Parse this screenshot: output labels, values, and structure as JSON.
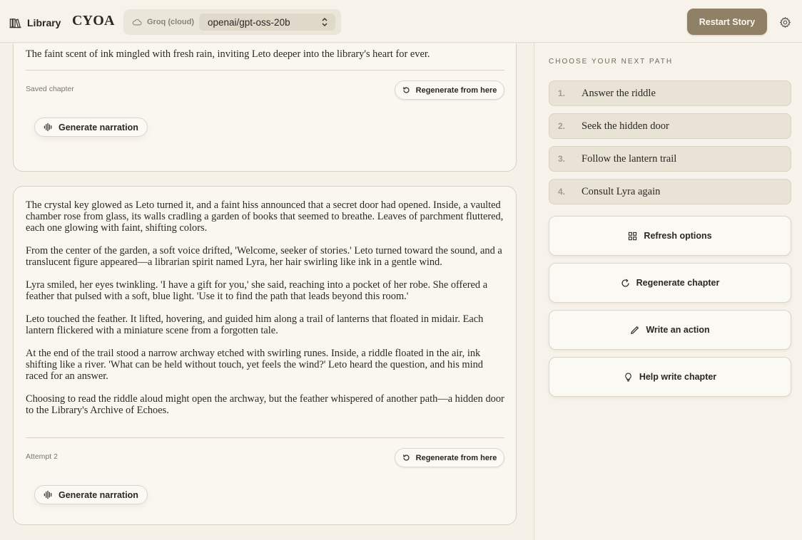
{
  "header": {
    "library_label": "Library",
    "brand": "CYOA",
    "provider_label": "Groq (cloud)",
    "model_value": "openai/gpt-oss-20b",
    "restart_label": "Restart Story",
    "icons": {
      "library": "library-icon",
      "provider": "cloud-icon",
      "model_caret": "chevron-updown-icon",
      "settings": "gear-icon"
    }
  },
  "story": {
    "chapters": [
      {
        "paragraphs": [
          "The faint scent of ink mingled with fresh rain, inviting Leto deeper into the library's heart for ever."
        ],
        "meta": "Saved chapter",
        "regenerate_label": "Regenerate from here",
        "narration_label": "Generate narration"
      },
      {
        "paragraphs": [
          "The crystal key glowed as Leto turned it, and a faint hiss announced that a secret door had opened. Inside, a vaulted chamber rose from glass, its walls cradling a garden of books that seemed to breathe. Leaves of parchment fluttered, each one glowing with faint, shifting colors.",
          "From the center of the garden, a soft voice drifted, 'Welcome, seeker of stories.' Leto turned toward the sound, and a translucent figure appeared—a librarian spirit named Lyra, her hair swirling like ink in a gentle wind.",
          "Lyra smiled, her eyes twinkling. 'I have a gift for you,' she said, reaching into a pocket of her robe. She offered a feather that pulsed with a soft, blue light. 'Use it to find the path that leads beyond this room.'",
          "Leto touched the feather. It lifted, hovering, and guided him along a trail of lanterns that floated in midair. Each lantern flickered with a miniature scene from a forgotten tale.",
          "At the end of the trail stood a narrow archway etched with swirling runes. Inside, a riddle floated in the air, ink shifting like a river. 'What can be held without touch, yet feels the wind?' Leto heard the question, and his mind raced for an answer.",
          "Choosing to read the riddle aloud might open the archway, but the feather whispered of another path—a hidden door to the Library's Archive of Echoes."
        ],
        "meta": "Attempt 2",
        "regenerate_label": "Regenerate from here",
        "narration_label": "Generate narration"
      }
    ]
  },
  "panel": {
    "heading": "CHOOSE YOUR NEXT PATH",
    "choices": [
      {
        "num": "1.",
        "label": "Answer the riddle"
      },
      {
        "num": "2.",
        "label": "Seek the hidden door"
      },
      {
        "num": "3.",
        "label": "Follow the lantern trail"
      },
      {
        "num": "4.",
        "label": "Consult Lyra again"
      }
    ],
    "actions": [
      {
        "label": "Refresh options",
        "icon": "grid-icon"
      },
      {
        "label": "Regenerate chapter",
        "icon": "refresh-icon"
      },
      {
        "label": "Write an action",
        "icon": "pencil-icon"
      },
      {
        "label": "Help write chapter",
        "icon": "lightbulb-icon"
      }
    ]
  },
  "colors": {
    "background": "#f5f1e8",
    "accent_button": "#8f8066",
    "choice_bg": "#e9e3d6",
    "text": "#2b2722"
  }
}
